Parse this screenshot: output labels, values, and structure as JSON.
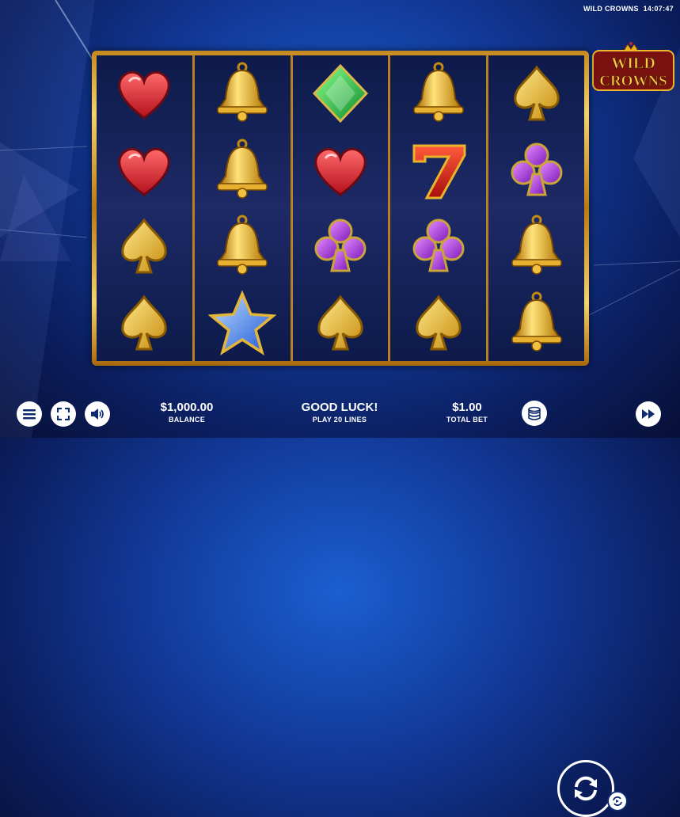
{
  "game": {
    "name": "WILD CROWNS",
    "time": "14:07:47"
  },
  "logo": {
    "line1": "WILD",
    "line2": "CROWNS"
  },
  "reels": [
    [
      "heart",
      "heart",
      "spade",
      "spade"
    ],
    [
      "bell",
      "bell",
      "bell",
      "star"
    ],
    [
      "diamond",
      "heart",
      "club",
      "spade"
    ],
    [
      "bell",
      "seven",
      "club",
      "spade"
    ],
    [
      "spade",
      "club",
      "bell",
      "bell"
    ]
  ],
  "footer": {
    "balance_value": "$1,000.00",
    "balance_label": "BALANCE",
    "message": "GOOD LUCK!",
    "lines_label": "PLAY 20 LINES",
    "bet_value": "$1.00",
    "bet_label": "TOTAL BET"
  },
  "icons": {
    "menu": "menu-icon",
    "fullscreen": "fullscreen-icon",
    "sound": "speaker-icon",
    "coins": "coins-icon",
    "spin": "spin-icon",
    "autoplay": "autoplay-icon",
    "turbo": "fast-forward-icon"
  }
}
